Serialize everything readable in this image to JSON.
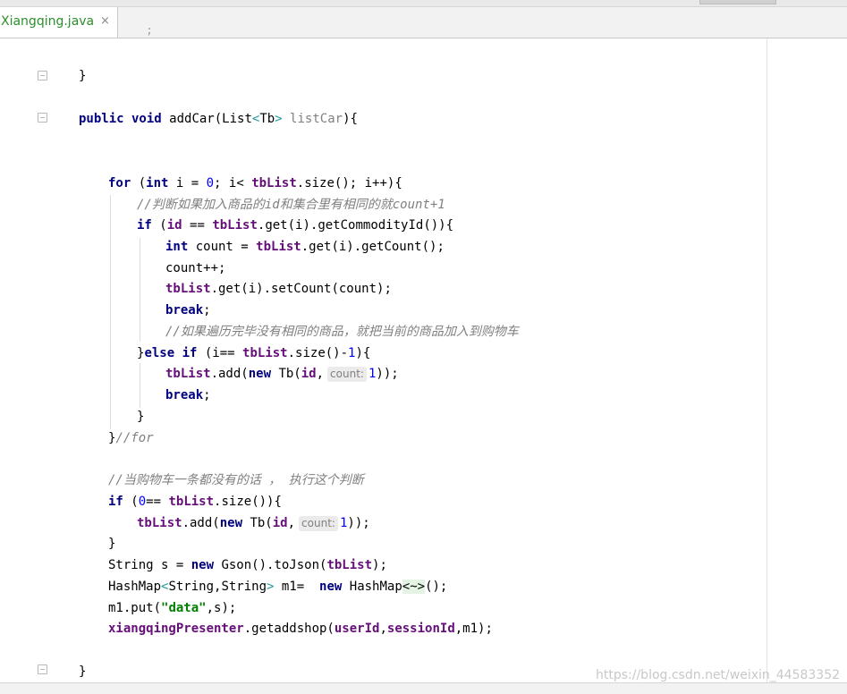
{
  "tab": {
    "filename": "Xiangqing.java",
    "close_glyph": "×"
  },
  "code_lines": [
    "}",
    "public void addCar(List<Tb> listCar){",
    "for (int i = 0; i< tbList.size(); i++){",
    "//判断如果加入商品的id和集合里有相同的就count+1",
    "if (id == tbList.get(i).getCommodityId()){",
    "int count = tbList.get(i).getCount();",
    "count++;",
    "tbList.get(i).setCount(count);",
    "break;",
    "//如果遍历完毕没有相同的商品，就把当前的商品加入到购物车",
    "}else if (i== tbList.size()-1){",
    "tbList.add(new Tb(id, count: 1));",
    "break;",
    "}",
    "}//for",
    "//当购物车一条都没有的话 ， 执行这个判断",
    "if (0== tbList.size()){",
    "tbList.add(new Tb(id, count: 1));",
    "}",
    "String s = new Gson().toJson(tbList);",
    "HashMap<String,String> m1=  new HashMap<~>();",
    "m1.put(\"data\",s);",
    "xiangqingPresenter.getaddshop(userId,sessionId,m1);",
    "}"
  ],
  "parameter_hint": "count:",
  "watermark": "https://blog.csdn.net/weixin_44583352"
}
